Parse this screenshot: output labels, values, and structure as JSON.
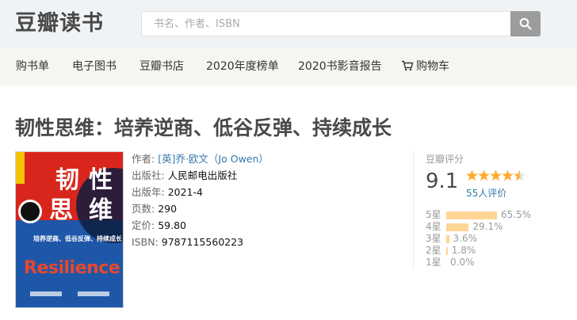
{
  "header": {
    "logo": "豆瓣读书",
    "search_placeholder": "书名、作者、ISBN"
  },
  "nav": {
    "items": [
      "购书单",
      "电子图书",
      "豆瓣书店",
      "2020年度榜单",
      "2020书影音报告",
      "购物车"
    ]
  },
  "book": {
    "title": "韧性思维：培养逆商、低谷反弹、持续成长",
    "cover": {
      "title_chars": [
        "韧",
        "性",
        "思",
        "维"
      ],
      "subtitle": "培养逆商、低谷反弹、持续成长",
      "english_word": "Resilience"
    },
    "info": {
      "author_label": "作者:",
      "author": "[英]乔·欧文（Jo Owen）",
      "publisher_label": "出版社:",
      "publisher": "人民邮电出版社",
      "pubdate_label": "出版年:",
      "pubdate": "2021-4",
      "pages_label": "页数:",
      "pages": "290",
      "price_label": "定价:",
      "price": "59.80",
      "isbn_label": "ISBN:",
      "isbn": "9787115560223"
    }
  },
  "rating": {
    "label": "豆瓣评分",
    "score": "9.1",
    "stars": 4.5,
    "count": "55人评价",
    "distribution": [
      {
        "label": "5星",
        "percent": 65.5,
        "text": "65.5%"
      },
      {
        "label": "4星",
        "percent": 29.1,
        "text": "29.1%"
      },
      {
        "label": "3星",
        "percent": 3.6,
        "text": "3.6%"
      },
      {
        "label": "2星",
        "percent": 1.8,
        "text": "1.8%"
      },
      {
        "label": "1星",
        "percent": 0.0,
        "text": "0.0%"
      }
    ]
  },
  "colors": {
    "link": "#3377aa",
    "star": "#ffac2d",
    "bar": "#ffd596",
    "header_bg": "#f0f3f5",
    "nav_bg": "#f6f6f1"
  }
}
